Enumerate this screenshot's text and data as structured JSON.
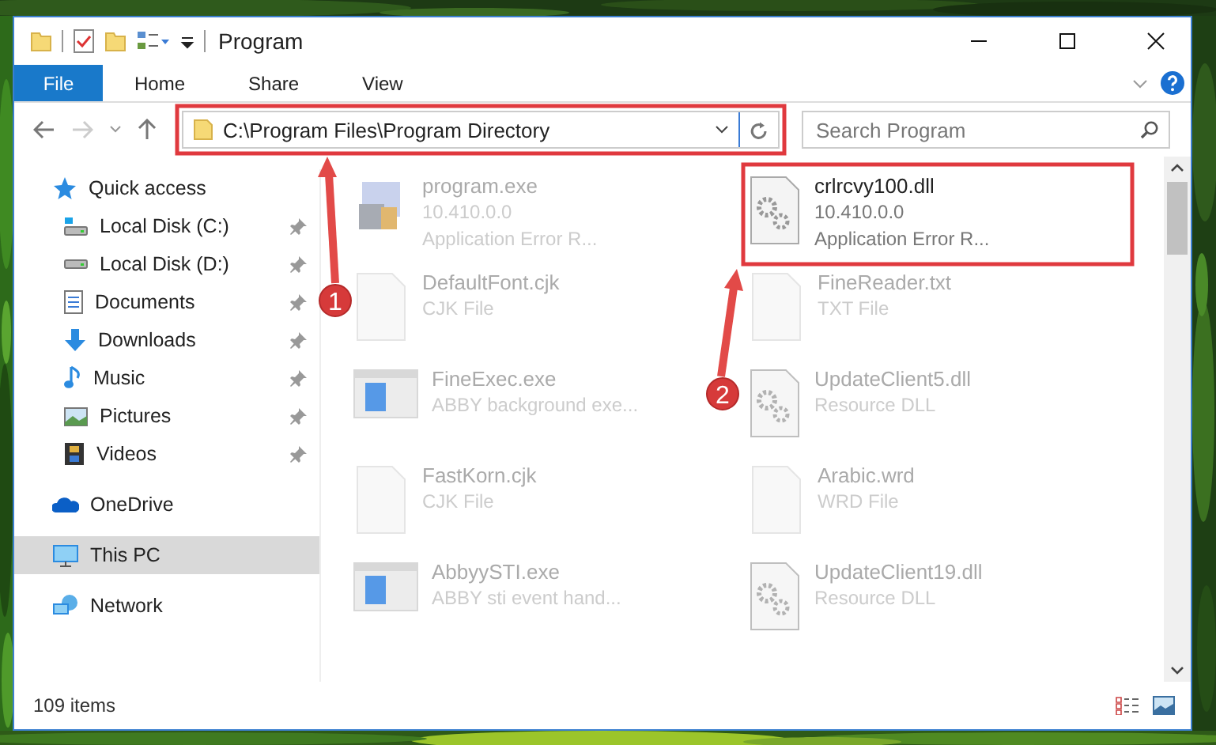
{
  "window": {
    "title": "Program"
  },
  "ribbon": {
    "tabs": [
      {
        "label": "File",
        "kind": "menu",
        "selected": false
      },
      {
        "label": "Home",
        "kind": "tab",
        "selected": false
      },
      {
        "label": "Share",
        "kind": "tab",
        "selected": false
      },
      {
        "label": "View",
        "kind": "tab",
        "selected": false
      }
    ]
  },
  "navigation": {
    "back_disabled": false,
    "forward_disabled": true
  },
  "address_bar": {
    "path": "C:\\Program Files\\Program Directory"
  },
  "search": {
    "placeholder": "Search Program"
  },
  "sidebar": {
    "items": [
      {
        "label": "Quick access",
        "pinned": false,
        "selected": false,
        "children": [
          {
            "label": "Local Disk (C:)",
            "pinned": true,
            "selected": false
          },
          {
            "label": "Local Disk (D:)",
            "pinned": true,
            "selected": false
          },
          {
            "label": "Documents",
            "pinned": true,
            "selected": false
          },
          {
            "label": "Downloads",
            "pinned": true,
            "selected": false
          },
          {
            "label": "Music",
            "pinned": true,
            "selected": false
          },
          {
            "label": "Pictures",
            "pinned": true,
            "selected": false
          },
          {
            "label": "Videos",
            "pinned": true,
            "selected": false
          }
        ]
      },
      {
        "label": "OneDrive",
        "pinned": false,
        "selected": false
      },
      {
        "label": "This PC",
        "pinned": false,
        "selected": true
      },
      {
        "label": "Network",
        "pinned": false,
        "selected": false
      }
    ]
  },
  "files": [
    {
      "name": "program.exe",
      "kind": "installer",
      "blurred": true,
      "details": [
        "10.410.0.0",
        "Application Error R..."
      ]
    },
    {
      "name": "crlrcvy100.dll",
      "kind": "gears",
      "blurred": false,
      "details": [
        "10.410.0.0",
        "Application Error R..."
      ]
    },
    {
      "name": "DefaultFont.cjk",
      "kind": "blank",
      "blurred": true,
      "details": [
        "CJK File"
      ]
    },
    {
      "name": "FineReader.txt",
      "kind": "blank",
      "blurred": true,
      "details": [
        "TXT File"
      ]
    },
    {
      "name": "FineExec.exe",
      "kind": "window",
      "blurred": true,
      "details": [
        "ABBY background exe..."
      ]
    },
    {
      "name": "UpdateClient5.dll",
      "kind": "gears",
      "blurred": true,
      "details": [
        "Resource DLL"
      ]
    },
    {
      "name": "FastKorn.cjk",
      "kind": "blank",
      "blurred": true,
      "details": [
        "CJK File"
      ]
    },
    {
      "name": "Arabic.wrd",
      "kind": "blank",
      "blurred": true,
      "details": [
        "WRD File"
      ]
    },
    {
      "name": "AbbyySTI.exe",
      "kind": "window",
      "blurred": true,
      "details": [
        "ABBY sti event hand..."
      ]
    },
    {
      "name": "UpdateClient19.dll",
      "kind": "gears",
      "blurred": true,
      "details": [
        "Resource DLL"
      ]
    }
  ],
  "status_bar": {
    "item_count": "109 items"
  },
  "annotations": [
    {
      "label": "1"
    },
    {
      "label": "2"
    }
  ]
}
